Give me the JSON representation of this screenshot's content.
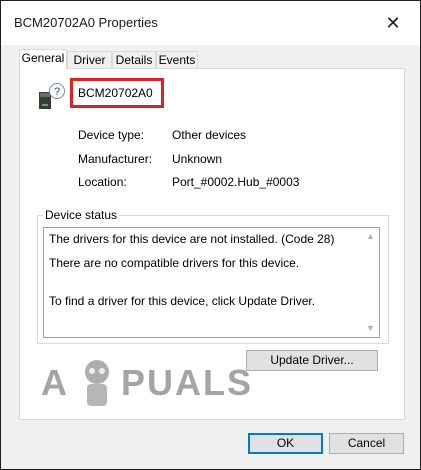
{
  "window": {
    "title": "BCM20702A0 Properties"
  },
  "tabs": [
    {
      "label": "General",
      "active": true
    },
    {
      "label": "Driver",
      "active": false
    },
    {
      "label": "Details",
      "active": false
    },
    {
      "label": "Events",
      "active": false
    }
  ],
  "device": {
    "name": "BCM20702A0",
    "icon": "unknown-device-icon"
  },
  "properties": [
    {
      "label": "Device type:",
      "value": "Other devices"
    },
    {
      "label": "Manufacturer:",
      "value": "Unknown"
    },
    {
      "label": "Location:",
      "value": "Port_#0002.Hub_#0003"
    }
  ],
  "status": {
    "group_label": "Device status",
    "lines": [
      "The drivers for this device are not installed. (Code 28)",
      "There are no compatible drivers for this device.",
      "To find a driver for this device, click Update Driver."
    ],
    "update_button": "Update Driver..."
  },
  "footer": {
    "ok_label": "OK",
    "cancel_label": "Cancel"
  },
  "watermark": {
    "left_text": "A",
    "right_text": "PUALS"
  },
  "colors": {
    "highlight": "#e02020",
    "accent": "#0078d7"
  }
}
